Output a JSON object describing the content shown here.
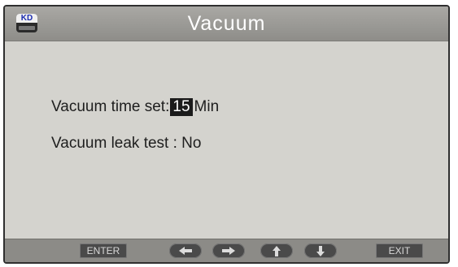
{
  "header": {
    "title": "Vacuum",
    "icon": "device-logo-icon",
    "icon_text": "KD"
  },
  "settings": {
    "vacuum_time_label": "Vacuum time set:",
    "vacuum_time_value": "15",
    "vacuum_time_unit": "Min",
    "leak_test_label": "Vacuum leak test :",
    "leak_test_value": "No"
  },
  "footer": {
    "enter_label": "ENTER",
    "exit_label": "EXIT",
    "keys": [
      "left-arrow-icon",
      "right-arrow-icon",
      "up-arrow-icon",
      "down-arrow-icon"
    ]
  },
  "colors": {
    "screen_bg": "#d4d3ce",
    "titlebar": "#9c9b97",
    "footer": "#8c8b87",
    "key_bg": "#4a4a4a",
    "highlight_bg": "#1b1b1b"
  }
}
